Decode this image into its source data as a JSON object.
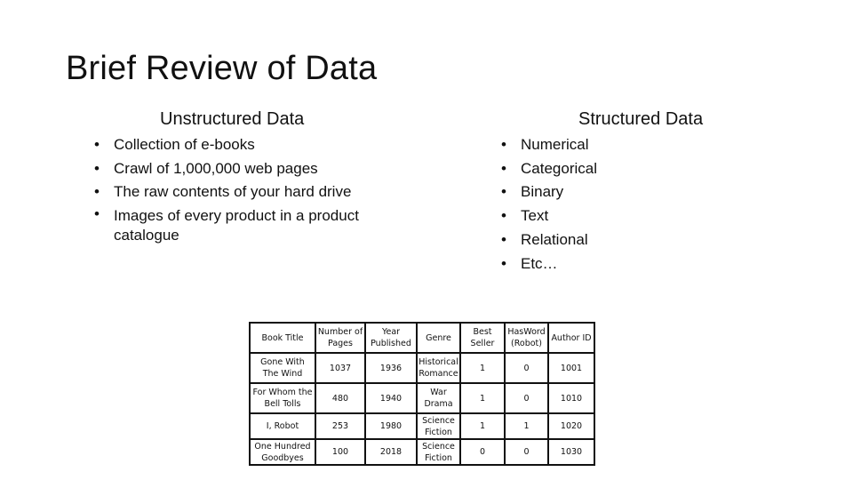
{
  "slide": {
    "title": "Brief Review of Data",
    "unstructured": {
      "heading": "Unstructured Data",
      "items": [
        "Collection of e-books",
        "Crawl of 1,000,000 web pages",
        "The raw contents of your hard drive",
        "Images of every product in a product catalogue"
      ]
    },
    "structured": {
      "heading": "Structured Data",
      "items": [
        "Numerical",
        "Categorical",
        "Binary",
        "Text",
        "Relational",
        "Etc…"
      ]
    }
  },
  "table": {
    "headers": [
      "Book Title",
      "Number of Pages",
      "Year Published",
      "Genre",
      "Best Seller",
      "HasWord (Robot)",
      "Author ID"
    ],
    "rows": [
      [
        "Gone With The Wind",
        "1037",
        "1936",
        "Historical Romance",
        "1",
        "0",
        "1001"
      ],
      [
        "For Whom the Bell Tolls",
        "480",
        "1940",
        "War Drama",
        "1",
        "0",
        "1010"
      ],
      [
        "I, Robot",
        "253",
        "1980",
        "Science Fiction",
        "1",
        "1",
        "1020"
      ],
      [
        "One Hundred Goodbyes",
        "100",
        "2018",
        "Science Fiction",
        "0",
        "0",
        "1030"
      ]
    ]
  }
}
